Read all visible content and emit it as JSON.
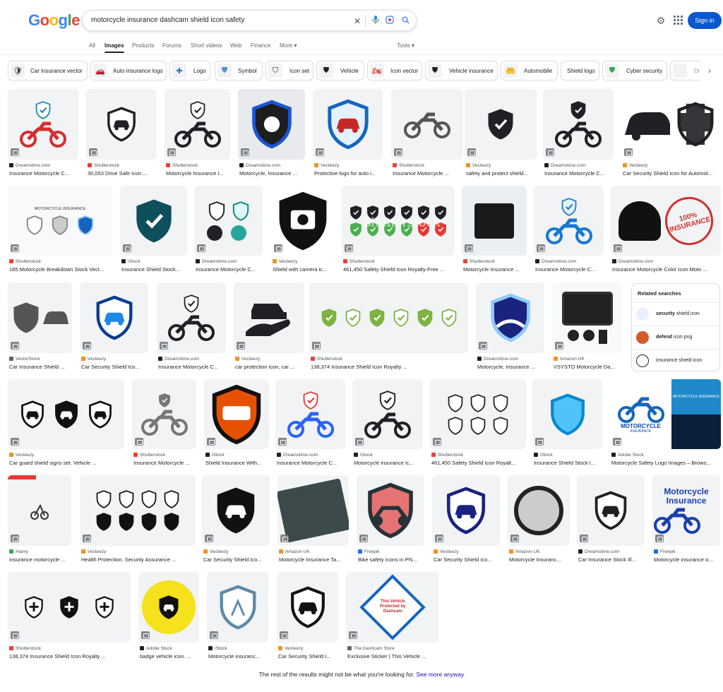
{
  "header": {
    "logo": [
      "G",
      "o",
      "o",
      "g",
      "l",
      "e"
    ],
    "query": "motorcycle insurance dashcam shield icon safety",
    "signin": "Sign in"
  },
  "tabs": [
    "All",
    "Images",
    "Products",
    "Forums",
    "Short videos",
    "Web",
    "Finance",
    "More ▾",
    "Tools ▾"
  ],
  "active_tab": "Images",
  "chips": [
    "Car insurance vector",
    "Auto insurance logo",
    "Logo",
    "Symbol",
    "Icon set",
    "Vehicle",
    "Icon vector",
    "Vehicle insurance",
    "Automobile",
    "Shield logo",
    "Cyber security",
    "Dr…"
  ],
  "rows": [
    [
      {
        "src": "Dreamstime.com",
        "title": "Insurance Motorcycle C...",
        "fav": "#202124"
      },
      {
        "src": "Shutterstock",
        "title": "30,053 Drive Safe Icon ...",
        "fav": "#ee4036"
      },
      {
        "src": "Shutterstock",
        "title": "Motorcycle Insurance I...",
        "fav": "#ee4036"
      },
      {
        "src": "Dreamstime.com",
        "title": "Motorcycle, Insurance ...",
        "fav": "#202124"
      },
      {
        "src": "Vecteezy",
        "title": "Protective logo for auto i...",
        "fav": "#f29222"
      },
      {
        "src": "Shutterstock",
        "title": "Insurance Motorcycle ...",
        "fav": "#ee4036"
      },
      {
        "src": "Vecteezy",
        "title": "safety and protect shield...",
        "fav": "#f29222"
      },
      {
        "src": "Dreamstime.com",
        "title": "Insurance Motorcycle C...",
        "fav": "#202124"
      },
      {
        "src": "Vecteezy",
        "title": "Car Security Shield Icon for Automot...",
        "fav": "#f29222"
      }
    ],
    [
      {
        "src": "Shutterstock",
        "title": "185 Motorcycle Breakdown Stock Vect...",
        "fav": "#ee4036"
      },
      {
        "src": "iStock",
        "title": "Insurance Shield Stock...",
        "fav": "#202124"
      },
      {
        "src": "Dreamstime.com",
        "title": "Insurance Motorcycle C...",
        "fav": "#202124"
      },
      {
        "src": "Vecteezy",
        "title": "Shield with camera ic...",
        "fav": "#f29222"
      },
      {
        "src": "Shutterstock",
        "title": "461,450 Safety Shield Icon Royalty-Free ...",
        "fav": "#ee4036"
      },
      {
        "src": "Shutterstock",
        "title": "Motorcycle Insurance ...",
        "fav": "#ee4036"
      },
      {
        "src": "Dreamstime.com",
        "title": "Insurance Motorcycle C...",
        "fav": "#202124"
      },
      {
        "src": "Dreamstime.com",
        "title": "Insurance Motorcycle Color Icon Moto ...",
        "fav": "#202124"
      }
    ],
    [
      {
        "src": "VectorStock",
        "title": "Car Insurance Shield ...",
        "fav": "#5f6368"
      },
      {
        "src": "Vecteezy",
        "title": "Car Security Shield Ico...",
        "fav": "#f29222"
      },
      {
        "src": "Dreamstime.com",
        "title": "Insurance Motorcycle C...",
        "fav": "#202124"
      },
      {
        "src": "Vecteezy",
        "title": "car protection icon, car ...",
        "fav": "#f29222"
      },
      {
        "src": "Shutterstock",
        "title": "138,374 Insurance Shield Icon Royalty ...",
        "fav": "#ee4036"
      },
      {
        "src": "Dreamstime.com",
        "title": "Motorcycle, Insurance ...",
        "fav": "#202124"
      },
      {
        "src": "Amazon UK",
        "title": "VSYSTO Motorcycle Da...",
        "fav": "#f29222"
      }
    ],
    [
      {
        "src": "Vecteezy",
        "title": "Car guard shield signs set. Vehicle ...",
        "fav": "#f29222"
      },
      {
        "src": "Shutterstock",
        "title": "Insurance Motorcycle ...",
        "fav": "#ee4036"
      },
      {
        "src": "iStock",
        "title": "Shield Insurance With...",
        "fav": "#202124"
      },
      {
        "src": "Dreamstime.com",
        "title": "Insurance Motorcycle C...",
        "fav": "#202124"
      },
      {
        "src": "iStock",
        "title": "Motorcycle insurance ic...",
        "fav": "#202124"
      },
      {
        "src": "Shutterstock",
        "title": "461,450 Safety Shield Icon Royalt...",
        "fav": "#ee4036"
      },
      {
        "src": "iStock",
        "title": "Insurance Shield Stock I...",
        "fav": "#202124"
      },
      {
        "src": "Adobe Stock",
        "title": "Motorcycle Safety Logo Images – Brows...",
        "fav": "#202124"
      }
    ],
    [
      {
        "src": "Alamy",
        "title": "Insurance motorcycle ...",
        "fav": "#34a853"
      },
      {
        "src": "Vecteezy",
        "title": "Health Protection, Security Assurance ...",
        "fav": "#f29222"
      },
      {
        "src": "Vecteezy",
        "title": "Car Security Shield Ico...",
        "fav": "#f29222"
      },
      {
        "src": "Amazon UK",
        "title": "Motorcycle Insurance Ta...",
        "fav": "#f29222"
      },
      {
        "src": "Freepik",
        "title": "Bike safety Icons in PN...",
        "fav": "#1a73e8"
      },
      {
        "src": "Vecteezy",
        "title": "Car Security Shield Ico...",
        "fav": "#f29222"
      },
      {
        "src": "Amazon UK",
        "title": "Motorcycle Insuranc...",
        "fav": "#f29222"
      },
      {
        "src": "Dreamstime.com",
        "title": "Car Insurance Stock Ill...",
        "fav": "#202124"
      },
      {
        "src": "Freepik",
        "title": "Motorcycle insurance ic...",
        "fav": "#1a73e8"
      }
    ],
    [
      {
        "src": "Shutterstock",
        "title": "138,374 Insurance Shield Icon Royalty ...",
        "fav": "#ee4036"
      },
      {
        "src": "Adobe Stock",
        "title": "badge vehicle icon. ...",
        "fav": "#202124"
      },
      {
        "src": "iStock",
        "title": "Motorcycle insuranc...",
        "fav": "#202124"
      },
      {
        "src": "Vecteezy",
        "title": "Car Security Shield I...",
        "fav": "#f29222"
      },
      {
        "src": "The Dashcam Store",
        "title": "Exclusive Sticker | This Vehicle ...",
        "fav": "#5f6368"
      }
    ]
  ],
  "image_text": {
    "motorcycle_insurance_banner": "MOTORCYCLE INSURANCE",
    "motorcycle_word": "MOTORCYCLE",
    "insurance_word": "INSURANCE",
    "stamp": "100% INSURANCE",
    "motorcycle_insurance_card": "Motorcycle Insurance",
    "sticker_top": "This Vehicle",
    "sticker_mid": "Protected by",
    "sticker_bottom": "Dashcam",
    "watermark": "shutterstock"
  },
  "related": {
    "heading": "Related searches",
    "items": [
      {
        "bold": "security",
        "rest": " shield icon",
        "color": "#e8f0fe"
      },
      {
        "bold": "defend",
        "rest": " icon png",
        "color": "#fce8e6"
      },
      {
        "bold": "",
        "rest": "insurance shield icon",
        "color": "#f1f3f4"
      }
    ]
  },
  "footer": {
    "text": "The rest of the results might not be what you're looking for. ",
    "link": "See more anyway"
  }
}
